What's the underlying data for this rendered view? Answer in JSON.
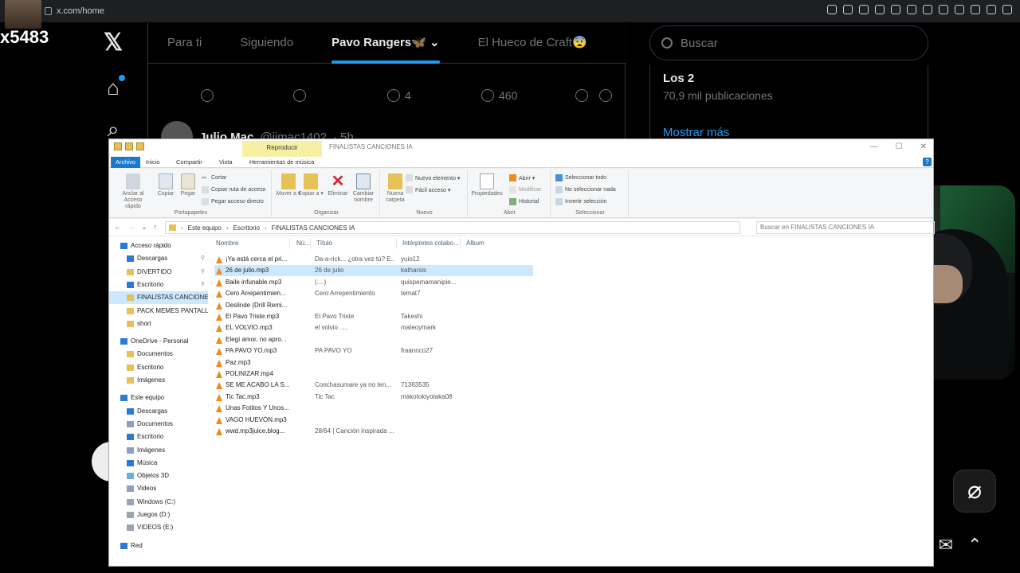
{
  "browser": {
    "url": "x.com/home"
  },
  "streamer": {
    "tag": "x5483"
  },
  "twitter": {
    "tabs": [
      {
        "label": "Para ti"
      },
      {
        "label": "Siguiendo"
      },
      {
        "label": "Pavo Rangers🦋",
        "active": true
      },
      {
        "label": "El Hueco de Craft😨"
      }
    ],
    "tab_dropdown": "⌄",
    "post_actions": {
      "likes": "4",
      "views": "460"
    },
    "next_post": {
      "name": "Julio Mac",
      "handle": "@jjmac1402",
      "time": "· 5h"
    },
    "search_placeholder": "Buscar",
    "trend": {
      "title": "Los 2",
      "count": "70,9 mil publicaciones",
      "show_more": "Mostrar más"
    }
  },
  "explorer": {
    "context_tab": "Reproducir",
    "title": "FINALISTAS CANCIONES IA",
    "ribbon_tabs": [
      "Archivo",
      "Inicio",
      "Compartir",
      "Vista",
      "Herramientas de música"
    ],
    "groups": {
      "portapapeles": {
        "label": "Portapapeles",
        "anclar": "Anclar al Acceso rápido",
        "copiar": "Copiar",
        "pegar": "Pegar",
        "cortar": "Cortar",
        "copiar_ruta": "Copiar ruta de acceso",
        "pegar_acceso": "Pegar acceso directo"
      },
      "organizar": {
        "label": "Organizar",
        "mover": "Mover a ▾",
        "copiar": "Copiar a ▾",
        "eliminar": "Eliminar",
        "cambiar": "Cambiar nombre"
      },
      "nuevo": {
        "label": "Nuevo",
        "carpeta": "Nueva carpeta",
        "elemento": "Nuevo elemento ▾",
        "facil": "Fácil acceso ▾"
      },
      "abrir": {
        "label": "Abrir",
        "propiedades": "Propiedades",
        "abrir": "Abrir ▾",
        "modificar": "Modificar",
        "historial": "Historial"
      },
      "seleccionar": {
        "label": "Seleccionar",
        "todo": "Seleccionar todo",
        "nada": "No seleccionar nada",
        "invertir": "Invertir selección"
      }
    },
    "breadcrumb": [
      "Este equipo",
      "Escritorio",
      "FINALISTAS CANCIONES IA"
    ],
    "search_placeholder": "Buscar en FINALISTAS CANCIONES IA",
    "nav": [
      {
        "label": "Acceso rápido",
        "indent": 0,
        "kind": "star"
      },
      {
        "label": "Descargas",
        "indent": 1,
        "kind": "download",
        "pinned": true
      },
      {
        "label": "DIVERTIDO",
        "indent": 1,
        "kind": "folder",
        "pinned": true
      },
      {
        "label": "Escritorio",
        "indent": 1,
        "kind": "desktop",
        "pinned": true
      },
      {
        "label": "FINALISTAS CANCIONES IA",
        "indent": 1,
        "kind": "folder",
        "selected": true
      },
      {
        "label": "PACK MEMES PANTALLA",
        "indent": 1,
        "kind": "folder"
      },
      {
        "label": "short",
        "indent": 1,
        "kind": "folder"
      },
      {
        "label": "",
        "indent": 0,
        "kind": "gap"
      },
      {
        "label": "OneDrive - Personal",
        "indent": 0,
        "kind": "cloud"
      },
      {
        "label": "Documentos",
        "indent": 1,
        "kind": "folder"
      },
      {
        "label": "Escritorio",
        "indent": 1,
        "kind": "folder"
      },
      {
        "label": "Imágenes",
        "indent": 1,
        "kind": "folder"
      },
      {
        "label": "",
        "indent": 0,
        "kind": "gap"
      },
      {
        "label": "Este equipo",
        "indent": 0,
        "kind": "pc"
      },
      {
        "label": "Descargas",
        "indent": 1,
        "kind": "download"
      },
      {
        "label": "Documentos",
        "indent": 1,
        "kind": "doc"
      },
      {
        "label": "Escritorio",
        "indent": 1,
        "kind": "desktop"
      },
      {
        "label": "Imágenes",
        "indent": 1,
        "kind": "image"
      },
      {
        "label": "Música",
        "indent": 1,
        "kind": "music"
      },
      {
        "label": "Objetos 3D",
        "indent": 1,
        "kind": "cube"
      },
      {
        "label": "Videos",
        "indent": 1,
        "kind": "video"
      },
      {
        "label": "Windows (C:)",
        "indent": 1,
        "kind": "drive"
      },
      {
        "label": "Juegos  (D:)",
        "indent": 1,
        "kind": "drive"
      },
      {
        "label": "VIDEOS (E:)",
        "indent": 1,
        "kind": "drive"
      },
      {
        "label": "",
        "indent": 0,
        "kind": "gap"
      },
      {
        "label": "Red",
        "indent": 0,
        "kind": "net"
      }
    ],
    "columns": {
      "name": "Nombre",
      "num": "Nú...",
      "title": "Título",
      "artist": "Intérpretes colabo...",
      "album": "Álbum"
    },
    "files": [
      {
        "name": "¡Ya está cerca el pri...",
        "title": "Da-a-rick... ¿otra vez tú? E...",
        "artist": "yuio12"
      },
      {
        "name": "26 de julio.mp3",
        "title": "26 de julio",
        "artist": "katharsis",
        "selected": true
      },
      {
        "name": "Baile infunable.mp3",
        "title": "(....)",
        "artist": "quispemamanipie..."
      },
      {
        "name": "Cero Arrepentimien...",
        "title": "Cero Arrepentimiento",
        "artist": "temat7"
      },
      {
        "name": "Deslinde (Drill Remi...",
        "title": "",
        "artist": ""
      },
      {
        "name": "El Pavo Triste.mp3",
        "title": "El Pavo Triste",
        "artist": "Takeshi"
      },
      {
        "name": "EL VOLVIO.mp3",
        "title": "el volvio .....",
        "artist": "mateoymark"
      },
      {
        "name": "Elegí amor, no apro...",
        "title": "",
        "artist": ""
      },
      {
        "name": "PA PAVO YO.mp3",
        "title": "PA PAVO YO",
        "artist": "fraannco27"
      },
      {
        "name": "Paz.mp3",
        "title": "",
        "artist": ""
      },
      {
        "name": "POLINIZAR.mp4",
        "title": "",
        "artist": ""
      },
      {
        "name": "SE ME ACABO LA S...",
        "title": "Conchasumare ya no ten...",
        "artist": "71363535"
      },
      {
        "name": "Tic Tac.mp3",
        "title": "Tic Tac",
        "artist": "makotokiyotaka08"
      },
      {
        "name": "Unas Fotitos Y Unos...",
        "title": "",
        "artist": ""
      },
      {
        "name": "VAGO HUEVÓN.mp3",
        "title": "",
        "artist": ""
      },
      {
        "name": "wwd.mp3juice.blog...",
        "title": "28/64 | Canción inspirada ...",
        "artist": ""
      }
    ]
  }
}
